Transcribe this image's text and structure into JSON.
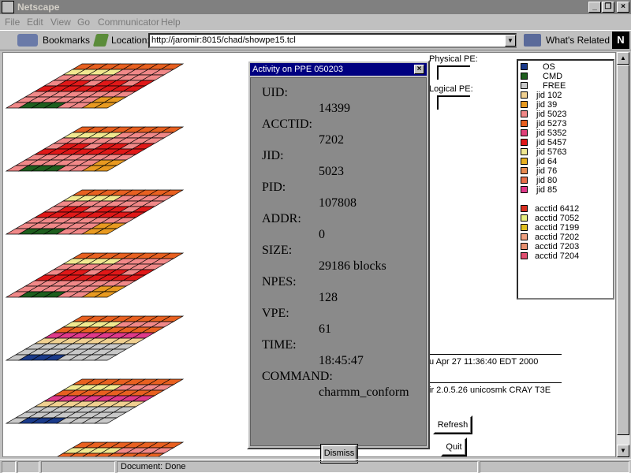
{
  "window": {
    "title": "Netscape"
  },
  "menu": [
    "File",
    "Edit",
    "View",
    "Go",
    "Communicator",
    "Help"
  ],
  "toolbar": {
    "bookmarks": "Bookmarks",
    "location_label": "Location:",
    "url": "http://jaromir:8015/chad/showpe15.tcl",
    "whats_related": "What's Related"
  },
  "status": {
    "text": "Document: Done"
  },
  "page": {
    "physical_pe": "Physical PE:",
    "logical_pe": "Logical  PE:",
    "date_text": "u Apr 27 11:36:40 EDT 2000",
    "system_text": "ir 2.0.5.26 unicosmk CRAY T3E",
    "refresh": "Refresh",
    "quit": "Quit"
  },
  "legend": [
    {
      "label": "OS",
      "color": "#1a3a8a"
    },
    {
      "label": "CMD",
      "color": "#1e5e1e"
    },
    {
      "label": "FREE",
      "color": "#c8c8c8"
    },
    {
      "label": "jid 102",
      "color": "#f0d090"
    },
    {
      "label": "jid 39",
      "color": "#e89a20"
    },
    {
      "label": "jid 5023",
      "color": "#f08888"
    },
    {
      "label": "jid 5273",
      "color": "#e86020"
    },
    {
      "label": "jid 5352",
      "color": "#e0407a"
    },
    {
      "label": "jid 5457",
      "color": "#e01818"
    },
    {
      "label": "jid 5763",
      "color": "#f0e890"
    },
    {
      "label": "jid 64",
      "color": "#e8b020"
    },
    {
      "label": "jid 76",
      "color": "#e88a50"
    },
    {
      "label": "jid 80",
      "color": "#e8704a"
    },
    {
      "label": "jid 85",
      "color": "#e03a8a"
    },
    {
      "label": "acctid 6412",
      "color": "#d83020"
    },
    {
      "label": "acctid 7052",
      "color": "#e8f080"
    },
    {
      "label": "acctid 7199",
      "color": "#e0c020"
    },
    {
      "label": "acctid 7202",
      "color": "#f0a080"
    },
    {
      "label": "acctid 7203",
      "color": "#e89070"
    },
    {
      "label": "acctid 7204",
      "color": "#e05070"
    }
  ],
  "dialog": {
    "title": "Activity on PPE 050203",
    "dismiss": "Dismiss",
    "fields": [
      {
        "label": "UID:",
        "value": "14399"
      },
      {
        "label": "ACCTID:",
        "value": "7202"
      },
      {
        "label": "JID:",
        "value": "5023"
      },
      {
        "label": "PID:",
        "value": "107808"
      },
      {
        "label": "ADDR:",
        "value": "0"
      },
      {
        "label": "SIZE:",
        "value": "29186 blocks"
      },
      {
        "label": "NPES:",
        "value": "128"
      },
      {
        "label": "VPE:",
        "value": "61"
      },
      {
        "label": "TIME:",
        "value": "18:45:47"
      },
      {
        "label": "COMMAND:",
        "value": "charmm_conform"
      }
    ]
  },
  "layer_colors": {
    "free": "#c8c8c8",
    "pink": "#f08888",
    "red": "#e01818",
    "orange": "#e86020",
    "peach": "#f0d090",
    "green": "#1e5e1e",
    "blue": "#1a3a8a",
    "magenta": "#e03a8a",
    "amber": "#e89a20",
    "yellow": "#f0e890"
  }
}
